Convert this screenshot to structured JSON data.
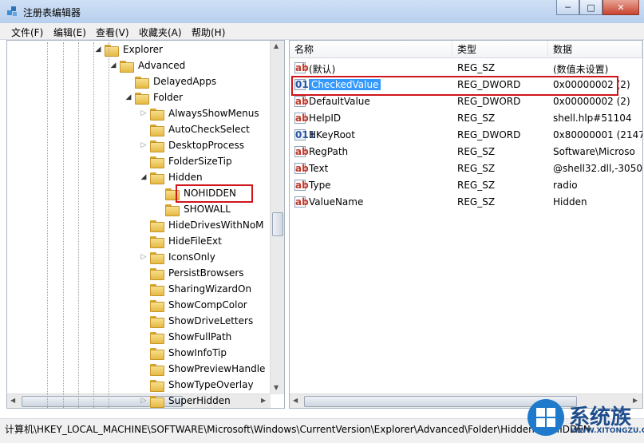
{
  "window": {
    "title": "注册表编辑器",
    "btn_min": "─",
    "btn_max": "□",
    "btn_close": "✕"
  },
  "menu": [
    "文件(F)",
    "编辑(E)",
    "查看(V)",
    "收藏夹(A)",
    "帮助(H)"
  ],
  "tree": [
    {
      "label": "Explorer",
      "state": "expanded"
    },
    {
      "label": "Advanced",
      "state": "expanded"
    },
    {
      "label": "DelayedApps",
      "state": "none"
    },
    {
      "label": "Folder",
      "state": "expanded"
    },
    {
      "label": "AlwaysShowMenus",
      "state": "collapsed"
    },
    {
      "label": "AutoCheckSelect",
      "state": "none"
    },
    {
      "label": "DesktopProcess",
      "state": "collapsed"
    },
    {
      "label": "FolderSizeTip",
      "state": "none"
    },
    {
      "label": "Hidden",
      "state": "expanded"
    },
    {
      "label": "NOHIDDEN",
      "state": "none"
    },
    {
      "label": "SHOWALL",
      "state": "none"
    },
    {
      "label": "HideDrivesWithNoM",
      "state": "none"
    },
    {
      "label": "HideFileExt",
      "state": "none"
    },
    {
      "label": "IconsOnly",
      "state": "collapsed"
    },
    {
      "label": "PersistBrowsers",
      "state": "none"
    },
    {
      "label": "SharingWizardOn",
      "state": "none"
    },
    {
      "label": "ShowCompColor",
      "state": "none"
    },
    {
      "label": "ShowDriveLetters",
      "state": "none"
    },
    {
      "label": "ShowFullPath",
      "state": "none"
    },
    {
      "label": "ShowInfoTip",
      "state": "none"
    },
    {
      "label": "ShowPreviewHandle",
      "state": "none"
    },
    {
      "label": "ShowTypeOverlay",
      "state": "none"
    },
    {
      "label": "SuperHidden",
      "state": "collapsed"
    }
  ],
  "columns": {
    "name": "名称",
    "type": "类型",
    "data": "数据"
  },
  "values": [
    {
      "icon": "ab",
      "name": "(默认)",
      "type": "REG_SZ",
      "data": "(数值未设置)"
    },
    {
      "icon": "bin",
      "name": "CheckedValue",
      "type": "REG_DWORD",
      "data": "0x00000002 (2)"
    },
    {
      "icon": "ab",
      "name": "DefaultValue",
      "type": "REG_DWORD",
      "data": "0x00000002 (2)"
    },
    {
      "icon": "ab",
      "name": "HelpID",
      "type": "REG_SZ",
      "data": "shell.hlp#51104"
    },
    {
      "icon": "bin",
      "name": "HKeyRoot",
      "type": "REG_DWORD",
      "data": "0x80000001 (2147"
    },
    {
      "icon": "ab",
      "name": "RegPath",
      "type": "REG_SZ",
      "data": "Software\\Microso"
    },
    {
      "icon": "ab",
      "name": "Text",
      "type": "REG_SZ",
      "data": "@shell32.dll,-3050"
    },
    {
      "icon": "ab",
      "name": "Type",
      "type": "REG_SZ",
      "data": "radio"
    },
    {
      "icon": "ab",
      "name": "ValueName",
      "type": "REG_SZ",
      "data": "Hidden"
    }
  ],
  "statusbar": {
    "path": "计算机\\HKEY_LOCAL_MACHINE\\SOFTWARE\\Microsoft\\Windows\\CurrentVersion\\Explorer\\Advanced\\Folder\\Hidden\\NOHIDDEN"
  },
  "watermark": {
    "text": "系统族",
    "sub": "WWW.XITONGZU.COM"
  },
  "colors": {
    "highlight": "#3399ff",
    "annotation_red": "#d0151b"
  }
}
